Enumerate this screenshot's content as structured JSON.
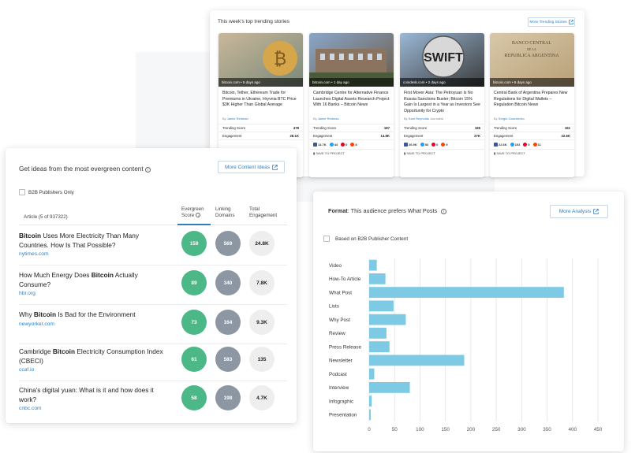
{
  "trending": {
    "title": "This week's top trending stories",
    "more_label": "More Trending Stories",
    "stories": [
      {
        "source": "bitcoin.com • 5 days ago",
        "headline": "Bitcoin, Tether, Ethereum Trade for Premiums in Ukraine, Hryvnia BTC Price $3K Higher Than Global Average",
        "by": "By",
        "author": "Jamie Redman",
        "extra": "",
        "score_label": "Trending Score",
        "score": "478",
        "engagement_label": "Engagement",
        "engagement": "28.1K",
        "fb": "",
        "tw": "",
        "pin": "",
        "rd": "",
        "save": "",
        "image_colors": [
          "#c9b79a",
          "#7a8a7a"
        ]
      },
      {
        "source": "bitcoin.com • 1 day ago",
        "headline": "Cambridge Centre for Alternative Finance Launches Digital Assets Research Project With 16 Banks – Bitcoin News",
        "by": "By",
        "author": "Jamie Redman",
        "extra": "",
        "score_label": "Trending Score",
        "score": "187",
        "engagement_label": "Engagement",
        "engagement": "14.8K",
        "fb": "14.7K",
        "tw": "44",
        "pin": "0",
        "rd": "8",
        "save": "SAVE TO PROJECT",
        "image_colors": [
          "#8aa6c8",
          "#6b5a48"
        ]
      },
      {
        "source": "coindesk.com • 2 days ago",
        "headline": "First Mover Asia: The Petroyuan Is No Russia Sanctions Buster; Bitcoin 15% Gain Is Largest in a Year as Investors See Opportunity for Crypto",
        "by": "By",
        "author": "Sam Reynolds",
        "extra": "Journalist",
        "score_label": "Trending Score",
        "score": "165",
        "engagement_label": "Engagement",
        "engagement": "27K",
        "fb": "26.9K",
        "tw": "53",
        "pin": "0",
        "rd": "9",
        "save": "SAVE TO PROJECT",
        "image_colors": [
          "#9bb8d6",
          "#3a3a3a"
        ]
      },
      {
        "source": "bitcoin.com • 6 days ago",
        "headline": "Central Bank of Argentina Prepares New Regulations for Digital Wallets – Regulation Bitcoin News",
        "by": "By",
        "author": "Sergio Goschenko",
        "extra": "",
        "score_label": "Trending Score",
        "score": "161",
        "engagement_label": "Engagement",
        "engagement": "22.6K",
        "fb": "22.6K",
        "tw": "103",
        "pin": "0",
        "rd": "11",
        "save": "SAVE TO PROJECT",
        "image_colors": [
          "#d8c8a8",
          "#b8a078"
        ],
        "sign": [
          "BANCO CENTRAL",
          "DE LA",
          "REPUBLICA ARGENTINA"
        ]
      }
    ]
  },
  "evergreen": {
    "title": "Get ideas from the most evergreen content",
    "more_label": "More Content Ideas",
    "b2b_label": "B2B Publishers Only",
    "col_article": "Article (5 of 937322)",
    "col_evergreen_1": "Evergreen",
    "col_evergreen_2": "Score",
    "col_linking_1": "Linking",
    "col_linking_2": "Domains",
    "col_total_1": "Total",
    "col_total_2": "Engagement",
    "rows": [
      {
        "pre": "",
        "bold": "Bitcoin",
        "post": " Uses More Electricity Than Many Countries. How Is That Possible?",
        "domain": "nytimes.com",
        "score": "159",
        "links": "569",
        "engagement": "24.8K"
      },
      {
        "pre": "How Much Energy Does ",
        "bold": "Bitcoin",
        "post": " Actually Consume?",
        "domain": "hbr.org",
        "score": "89",
        "links": "340",
        "engagement": "7.8K"
      },
      {
        "pre": "Why ",
        "bold": "Bitcoin",
        "post": " Is Bad for the Environment",
        "domain": "newyorker.com",
        "score": "73",
        "links": "164",
        "engagement": "9.3K"
      },
      {
        "pre": "Cambridge ",
        "bold": "Bitcoin",
        "post": " Electricity Consumption Index (CBECI)",
        "domain": "ccaf.io",
        "score": "61",
        "links": "583",
        "engagement": "135"
      },
      {
        "pre": "China's digital yuan: What is it and how does it work?",
        "bold": "",
        "post": "",
        "domain": "cnbc.com",
        "score": "58",
        "links": "198",
        "engagement": "4.7K"
      }
    ]
  },
  "format": {
    "title_bold": "Format",
    "title_rest": ": This audience prefers What Posts",
    "more_label": "More Analysis",
    "b2b_label": "Based on B2B Publisher Content"
  },
  "chart_data": {
    "type": "bar",
    "orientation": "horizontal",
    "categories": [
      "Video",
      "How-To Article",
      "What Post",
      "Lists",
      "Why Post",
      "Review",
      "Press Release",
      "Newsletter",
      "Podcast",
      "Interview",
      "Infographic",
      "Presentation"
    ],
    "values": [
      15,
      32,
      383,
      48,
      72,
      34,
      40,
      187,
      10,
      80,
      5,
      3
    ],
    "xlim": [
      0,
      450
    ],
    "xticks": [
      0,
      50,
      100,
      150,
      200,
      250,
      300,
      350,
      400,
      450
    ],
    "grid": true,
    "bar_color": "#7ecae4"
  },
  "colors": {
    "accent": "#2d7fc4",
    "evergreen_bubble": "#4cb888",
    "linking_bubble": "#8c97a3",
    "engagement_bubble": "#eeeeee",
    "facebook": "#3b5998",
    "twitter": "#1da1f2",
    "pinterest": "#e60023",
    "reddit": "#ff4500"
  }
}
